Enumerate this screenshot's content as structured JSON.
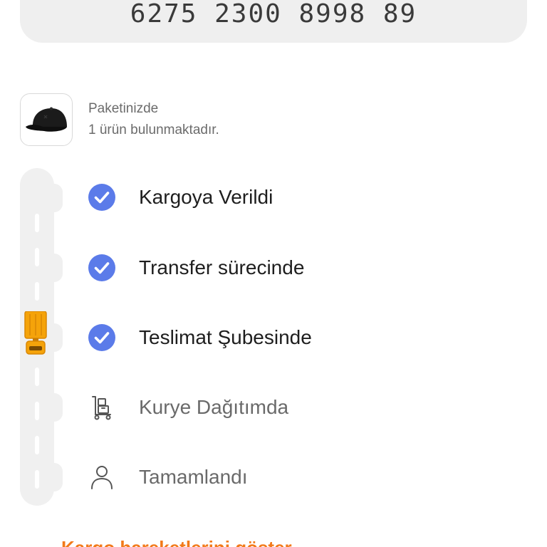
{
  "tracking": {
    "number": "6275 2300 8998 89"
  },
  "package": {
    "line1": "Paketinizde",
    "line2": "1 ürün bulunmaktadır.",
    "thumbnail_icon": "black-cap-icon"
  },
  "steps": [
    {
      "label": "Kargoya Verildi",
      "status": "done",
      "icon": "check-circle-icon"
    },
    {
      "label": "Transfer sürecinde",
      "status": "done",
      "icon": "check-circle-icon"
    },
    {
      "label": "Teslimat Şubesinde",
      "status": "done",
      "icon": "check-circle-icon"
    },
    {
      "label": "Kurye Dağıtımda",
      "status": "pending",
      "icon": "courier-cart-icon"
    },
    {
      "label": "Tamamlandı",
      "status": "pending",
      "icon": "person-icon"
    }
  ],
  "link": {
    "label": "Kargo hareketlerini göster"
  },
  "colors": {
    "accent": "#f27a1a",
    "check": "#5b7be9",
    "truck": "#f5a30a",
    "road": "#f0f0f0"
  }
}
